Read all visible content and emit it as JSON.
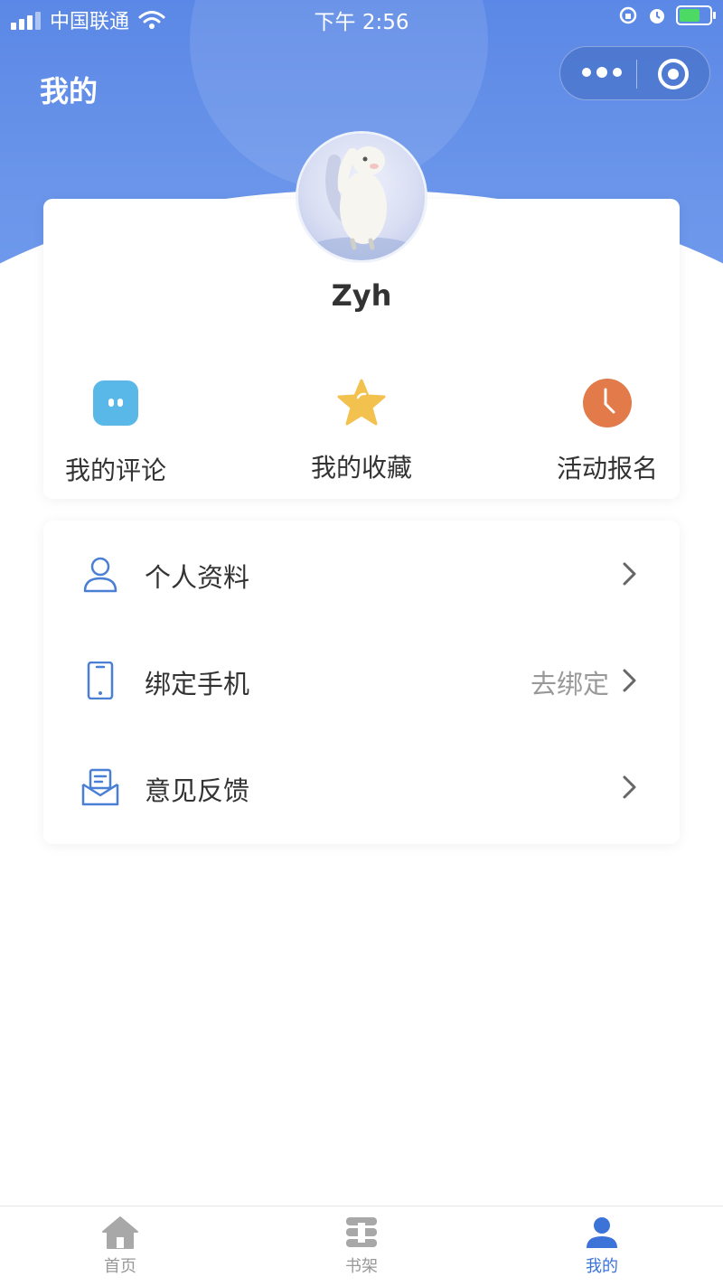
{
  "status_bar": {
    "carrier": "中国联通",
    "time": "下午 2:56",
    "icons": [
      "signal-icon",
      "wifi-icon",
      "orientation-lock-icon",
      "alarm-icon",
      "battery-charging-icon"
    ]
  },
  "header": {
    "title": "我的",
    "capsule": {
      "icons": [
        "more-icon",
        "close-target-icon"
      ]
    },
    "background_color": "#5B88E6"
  },
  "profile": {
    "username": "Zyh",
    "avatar": "avatar-illustration"
  },
  "quick_actions": [
    {
      "label": "我的评论",
      "icon": "comment-icon",
      "color": "#5AB8E8"
    },
    {
      "label": "我的收藏",
      "icon": "star-icon",
      "color": "#F2C14E"
    },
    {
      "label": "活动报名",
      "icon": "clock-icon",
      "color": "#E27A4A"
    }
  ],
  "menu": [
    {
      "label": "个人资料",
      "icon": "user-icon",
      "extra": ""
    },
    {
      "label": "绑定手机",
      "icon": "phone-icon",
      "extra": "去绑定"
    },
    {
      "label": "意见反馈",
      "icon": "feedback-mail-icon",
      "extra": ""
    }
  ],
  "tabbar": {
    "active_color": "#3B73D9",
    "inactive_color": "#999999",
    "tabs": [
      {
        "label": "首页",
        "icon": "home-icon",
        "active": false
      },
      {
        "label": "书架",
        "icon": "bookshelf-icon",
        "active": false
      },
      {
        "label": "我的",
        "icon": "profile-icon",
        "active": true
      }
    ]
  }
}
